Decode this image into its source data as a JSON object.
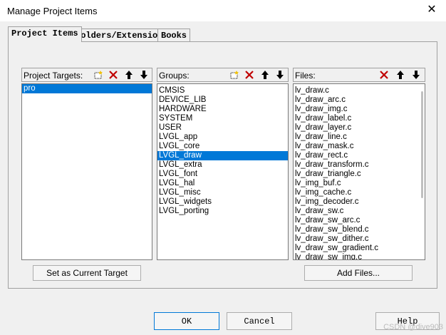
{
  "window": {
    "title": "Manage Project Items",
    "close_glyph": "✕"
  },
  "tabs": [
    {
      "label": "Project Items"
    },
    {
      "label": "Folders/Extensions"
    },
    {
      "label": "Books"
    }
  ],
  "targets": {
    "title": "Project Targets:",
    "items": [
      "pro"
    ],
    "selected_index": 0,
    "set_current_label": "Set as Current Target"
  },
  "groups": {
    "title": "Groups:",
    "items": [
      "CMSIS",
      "DEVICE_LIB",
      "HARDWARE",
      "SYSTEM",
      "USER",
      "LVGL_app",
      "LVGL_core",
      "LVGL_draw",
      "LVGL_extra",
      "LVGL_font",
      "LVGL_hal",
      "LVGL_misc",
      "LVGL_widgets",
      "LVGL_porting"
    ],
    "selected_index": 7
  },
  "files": {
    "title": "Files:",
    "items": [
      "lv_draw.c",
      "lv_draw_arc.c",
      "lv_draw_img.c",
      "lv_draw_label.c",
      "lv_draw_layer.c",
      "lv_draw_line.c",
      "lv_draw_mask.c",
      "lv_draw_rect.c",
      "lv_draw_transform.c",
      "lv_draw_triangle.c",
      "lv_img_buf.c",
      "lv_img_cache.c",
      "lv_img_decoder.c",
      "lv_draw_sw.c",
      "lv_draw_sw_arc.c",
      "lv_draw_sw_blend.c",
      "lv_draw_sw_dither.c",
      "lv_draw_sw_gradient.c",
      "lv_draw_sw_img.c"
    ],
    "add_label": "Add Files..."
  },
  "footer": {
    "ok_label": "OK",
    "cancel_label": "Cancel",
    "help_label": "Help"
  },
  "watermark": "CSDN @dive903",
  "colors": {
    "selection": "#0078d7",
    "delete_icon": "#c00000"
  }
}
